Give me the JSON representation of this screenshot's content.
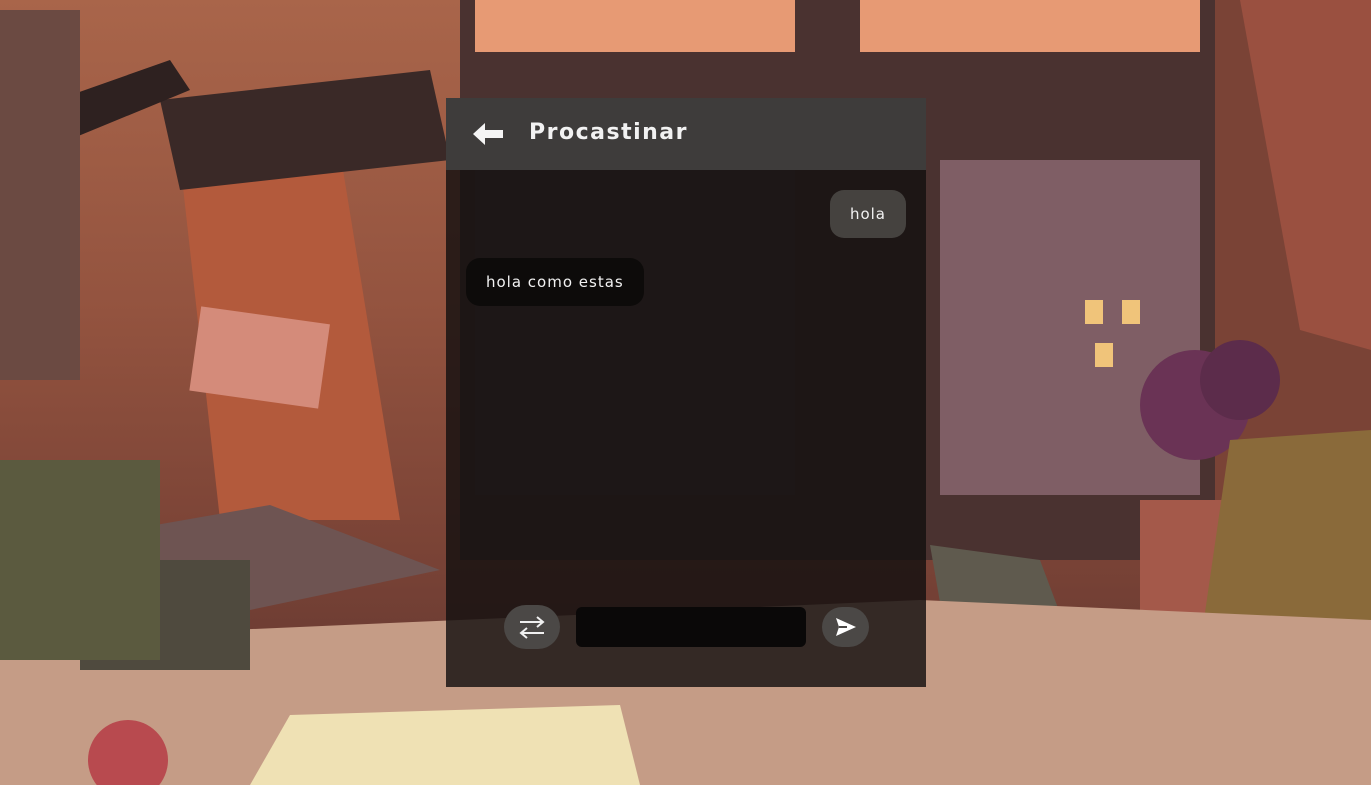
{
  "header": {
    "title": "Procastinar",
    "back_icon": "arrow-left-icon"
  },
  "messages": [
    {
      "direction": "outgoing",
      "text": "hola"
    },
    {
      "direction": "incoming",
      "text": "hola como estas"
    }
  ],
  "composer": {
    "input_value": "",
    "input_placeholder": "",
    "swap_icon": "swap-arrows-icon",
    "send_icon": "send-icon"
  },
  "colors": {
    "header_bg": "#3e3c3b",
    "outgoing_bubble": "#45423f",
    "incoming_bubble": "#0d0b0a",
    "text": "#f2f2f2"
  }
}
